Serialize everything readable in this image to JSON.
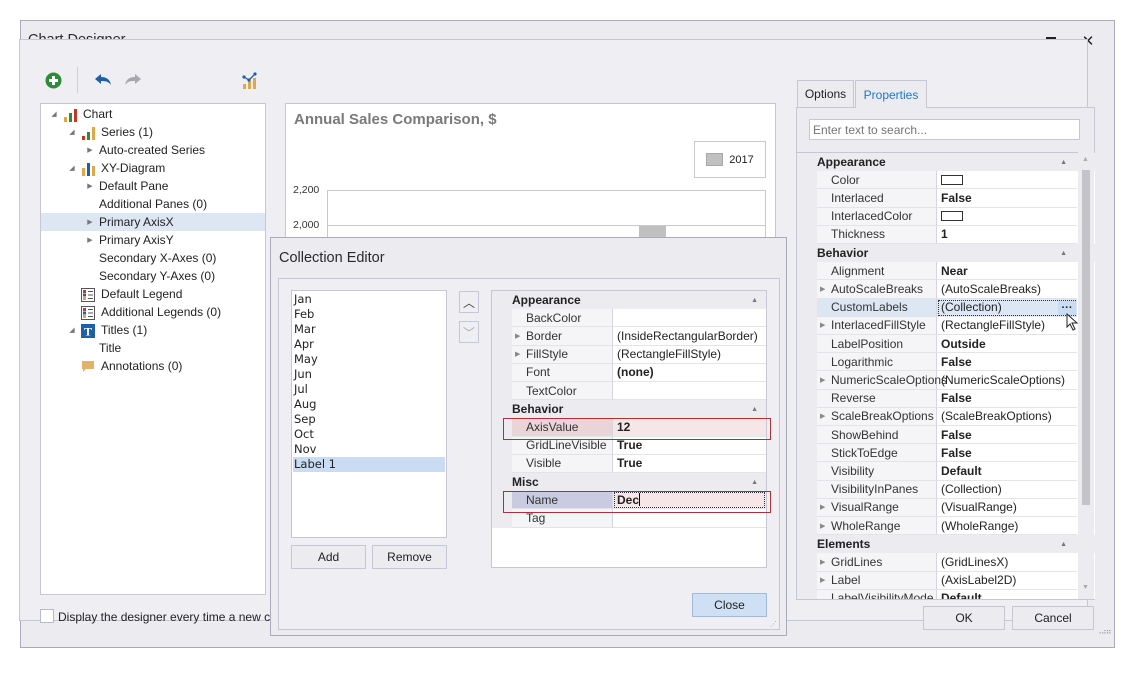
{
  "window": {
    "title": "Chart Designer",
    "maximize_icon": "maximize-icon",
    "close_icon": "close-icon"
  },
  "toolbar": {
    "add_icon": "add-element-icon",
    "undo_icon": "undo-icon",
    "redo_icon": "redo-icon",
    "chart_wizard_icon": "chart-type-icon"
  },
  "tree": {
    "items": [
      {
        "label": "Chart",
        "level": 0,
        "expander": "expanded",
        "icon": "chart-icon"
      },
      {
        "label": "Series (1)",
        "level": 1,
        "expander": "expanded",
        "icon": "series-icon"
      },
      {
        "label": "Auto-created Series",
        "level": 2,
        "expander": "collapsed",
        "icon": ""
      },
      {
        "label": "XY-Diagram",
        "level": 1,
        "expander": "expanded",
        "icon": "diagram-icon"
      },
      {
        "label": "Default Pane",
        "level": 2,
        "expander": "collapsed",
        "icon": ""
      },
      {
        "label": "Additional Panes (0)",
        "level": 2,
        "expander": "",
        "icon": ""
      },
      {
        "label": "Primary AxisX",
        "level": 2,
        "expander": "collapsed",
        "icon": "",
        "selected": true
      },
      {
        "label": "Primary AxisY",
        "level": 2,
        "expander": "collapsed",
        "icon": ""
      },
      {
        "label": "Secondary X-Axes (0)",
        "level": 2,
        "expander": "",
        "icon": ""
      },
      {
        "label": "Secondary Y-Axes (0)",
        "level": 2,
        "expander": "",
        "icon": ""
      },
      {
        "label": "Default Legend",
        "level": 1,
        "expander": "",
        "icon": "legend-icon"
      },
      {
        "label": "Additional Legends (0)",
        "level": 1,
        "expander": "",
        "icon": "legend-icon"
      },
      {
        "label": "Titles (1)",
        "level": 1,
        "expander": "expanded",
        "icon": "title-icon"
      },
      {
        "label": "Title",
        "level": 2,
        "expander": "",
        "icon": ""
      },
      {
        "label": "Annotations (0)",
        "level": 1,
        "expander": "",
        "icon": "annotation-icon"
      }
    ]
  },
  "preview": {
    "title": "Annual Sales Comparison, $",
    "legend_label": "2017",
    "y_ticks": [
      "2,200",
      "2,000"
    ]
  },
  "footer": {
    "checkbox_label": "Display the designer every time a new chart",
    "checkbox_checked": false,
    "ok_label": "OK",
    "cancel_label": "Cancel"
  },
  "collection_editor": {
    "title": "Collection Editor",
    "items": [
      "Jan",
      "Feb",
      "Mar",
      "Apr",
      "May",
      "Jun",
      "Jul",
      "Aug",
      "Sep",
      "Oct",
      "Nov",
      "Label 1"
    ],
    "selected_index": 11,
    "add_label": "Add",
    "remove_label": "Remove",
    "close_label": "Close",
    "move_up_icon": "chevron-up-icon",
    "move_down_icon": "chevron-down-icon",
    "categories": [
      {
        "name": "Appearance",
        "rows": [
          {
            "name": "BackColor",
            "value": "",
            "bold": false,
            "expandable": false
          },
          {
            "name": "Border",
            "value": "(InsideRectangularBorder)",
            "bold": false,
            "expandable": true
          },
          {
            "name": "FillStyle",
            "value": "(RectangleFillStyle)",
            "bold": false,
            "expandable": true
          },
          {
            "name": "Font",
            "value": "(none)",
            "bold": true,
            "expandable": false
          },
          {
            "name": "TextColor",
            "value": "",
            "bold": false,
            "expandable": false
          }
        ]
      },
      {
        "name": "Behavior",
        "rows": [
          {
            "name": "AxisValue",
            "value": "12",
            "bold": true,
            "expandable": false,
            "highlight": true
          },
          {
            "name": "GridLineVisible",
            "value": "True",
            "bold": true,
            "expandable": false
          },
          {
            "name": "Visible",
            "value": "True",
            "bold": true,
            "expandable": false
          }
        ]
      },
      {
        "name": "Misc",
        "rows": [
          {
            "name": "Name",
            "value": "Dec",
            "bold": true,
            "expandable": false,
            "editing": true
          },
          {
            "name": "Tag",
            "value": "",
            "bold": false,
            "expandable": false
          }
        ]
      }
    ]
  },
  "properties_panel": {
    "tabs": [
      {
        "label": "Options",
        "active": false
      },
      {
        "label": "Properties",
        "active": true
      }
    ],
    "search_placeholder": "Enter text to search...",
    "categories": [
      {
        "name": "Appearance",
        "rows": [
          {
            "name": "Color",
            "value": "",
            "swatch": true
          },
          {
            "name": "Interlaced",
            "value": "False",
            "bold": true
          },
          {
            "name": "InterlacedColor",
            "value": "",
            "swatch": true
          },
          {
            "name": "Thickness",
            "value": "1",
            "bold": true
          }
        ]
      },
      {
        "name": "Behavior",
        "rows": [
          {
            "name": "Alignment",
            "value": "Near",
            "bold": true
          },
          {
            "name": "AutoScaleBreaks",
            "value": "(AutoScaleBreaks)",
            "expandable": true
          },
          {
            "name": "CustomLabels",
            "value": "(Collection)",
            "selected": true,
            "ellipsis": true
          },
          {
            "name": "InterlacedFillStyle",
            "value": "(RectangleFillStyle)",
            "expandable": true
          },
          {
            "name": "LabelPosition",
            "value": "Outside",
            "bold": true
          },
          {
            "name": "Logarithmic",
            "value": "False",
            "bold": true
          },
          {
            "name": "NumericScaleOptions",
            "value": "(NumericScaleOptions)",
            "expandable": true
          },
          {
            "name": "Reverse",
            "value": "False",
            "bold": true
          },
          {
            "name": "ScaleBreakOptions",
            "value": "(ScaleBreakOptions)",
            "expandable": true
          },
          {
            "name": "ShowBehind",
            "value": "False",
            "bold": true
          },
          {
            "name": "StickToEdge",
            "value": "False",
            "bold": true
          },
          {
            "name": "Visibility",
            "value": "Default",
            "bold": true
          },
          {
            "name": "VisibilityInPanes",
            "value": "(Collection)"
          },
          {
            "name": "VisualRange",
            "value": "(VisualRange)",
            "expandable": true
          },
          {
            "name": "WholeRange",
            "value": "(WholeRange)",
            "expandable": true
          }
        ]
      },
      {
        "name": "Elements",
        "rows": [
          {
            "name": "GridLines",
            "value": "(GridLinesX)",
            "expandable": true
          },
          {
            "name": "Label",
            "value": "(AxisLabel2D)",
            "expandable": true
          },
          {
            "name": "LabelVisibilityMode",
            "value": "Default",
            "bold": true
          }
        ]
      }
    ]
  },
  "colors": {
    "accent": "#1e78c8",
    "selection": "#dde7f4",
    "highlight_border": "#b03038",
    "add_green": "#2e8b3a",
    "undo_blue": "#1f5fa8"
  }
}
